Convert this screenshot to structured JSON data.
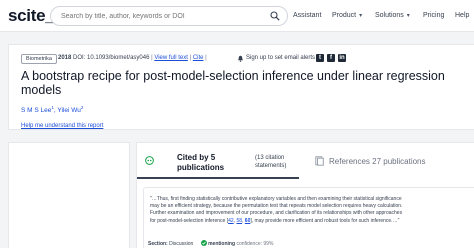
{
  "header": {
    "logo": "scite_",
    "search_placeholder": "Search by title, author, keywords or DOI",
    "nav": {
      "assistant": "Assistant",
      "product": "Product",
      "solutions": "Solutions",
      "pricing": "Pricing",
      "help": "Help"
    }
  },
  "article": {
    "journal": "Biometrika",
    "year": "2018",
    "doi": "DOI: 10.1093/biomet/asy046",
    "sep": "|",
    "view_full_text": "View full text",
    "cite": "Cite",
    "alert": "Sign up to set email alerts",
    "title": "A bootstrap recipe for post-model-selection inference under linear regression models",
    "authors": [
      {
        "name": "S M S Lee",
        "sup": "1"
      },
      {
        "name": "Yilei Wu",
        "sup": "2"
      }
    ],
    "author_sep": ", ",
    "help_link": "Help me understand this report"
  },
  "tabs": {
    "cited_label": "Cited by 5 publications",
    "citation_count": "(13 citation statements)",
    "refs_label": "References 27 publications"
  },
  "citation": {
    "snippet_pre": "\"…Thus, first finding statistically contributive explanatory variables and then examining their statistical significance may be an efficient strategy, because the permutation test that repeats model selection requires heavy calculation. Further examination and improvement of our procedure, and clarification of its relationships with other approaches for post-model-selection inference ",
    "refs": [
      "42",
      "58",
      "60"
    ],
    "snippet_post": ", may provide more efficient and robust tools for such inference.…\"",
    "section_label": "Section:",
    "section_value": "Discussion",
    "type": "mentioning",
    "confidence": "confidence: 99%"
  },
  "colors": {
    "brand": "#111827",
    "link": "#1d4ed8",
    "mentioning": "#16a34a"
  }
}
